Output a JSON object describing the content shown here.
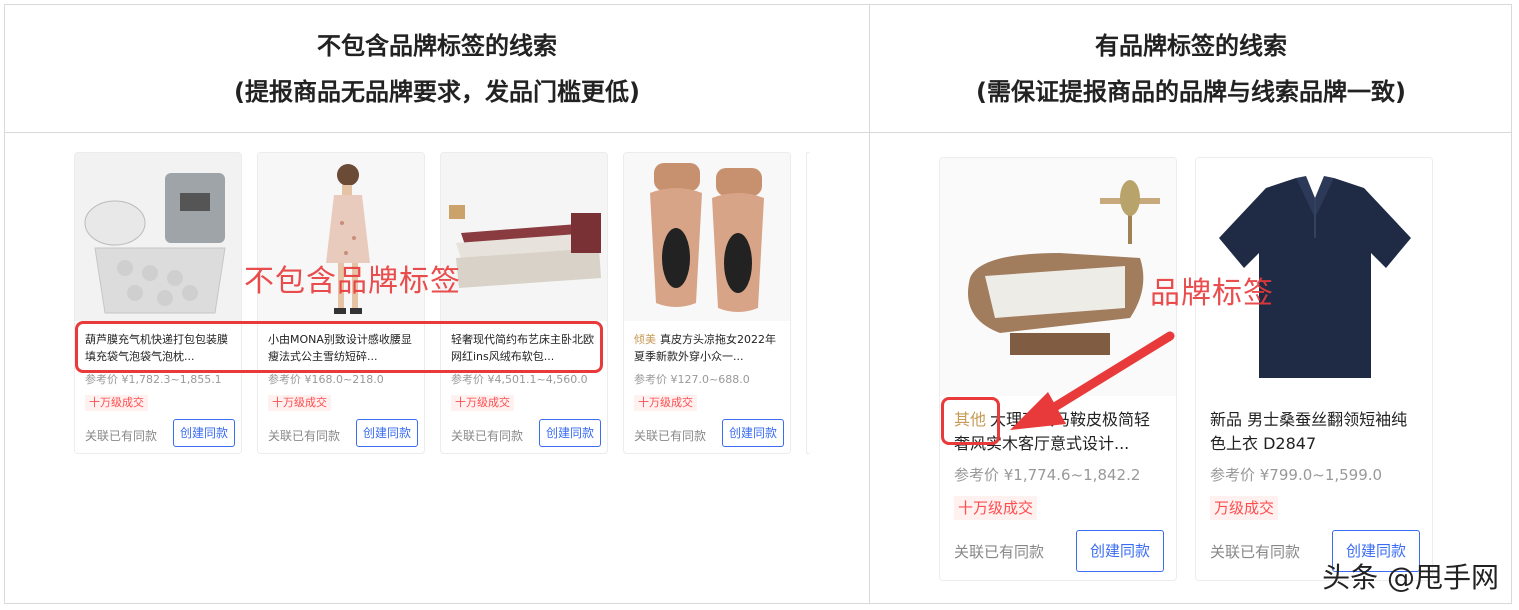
{
  "header": {
    "left_title": "不包含品牌标签的线索",
    "left_subtitle": "(提报商品无品牌要求，发品门槛更低)",
    "right_title": "有品牌标签的线索",
    "right_subtitle": "(需保证提报商品的品牌与线索品牌一致)"
  },
  "left_cards": [
    {
      "title": "葫芦膜充气机快递打包包装膜填充袋气泡袋气泡枕...",
      "price": "参考价 ¥1,782.3~1,855.1",
      "deal": "十万级成交",
      "assoc": "关联已有同款",
      "btn": "创建同款",
      "image": "air-cushion-machine"
    },
    {
      "title": "小由MONA别致设计感收腰显瘦法式公主雪纺短碎...",
      "price": "参考价 ¥168.0~218.0",
      "deal": "十万级成交",
      "assoc": "关联已有同款",
      "btn": "创建同款",
      "image": "floral-dress-model"
    },
    {
      "title": "轻奢现代简约布艺床主卧北欧网红ins风绒布软包...",
      "price": "参考价 ¥4,501.1~4,560.0",
      "deal": "十万级成交",
      "assoc": "关联已有同款",
      "btn": "创建同款",
      "image": "fabric-bed"
    },
    {
      "brand": "倾美",
      "title": "真皮方头凉拖女2022年夏季新款外穿小众一...",
      "price": "参考价 ¥127.0~688.0",
      "deal": "十万级成交",
      "assoc": "关联已有同款",
      "btn": "创建同款",
      "image": "sandals"
    }
  ],
  "right_cards": [
    {
      "brand": "其他",
      "title": "大理石风马鞍皮极简轻奢风实木客厅意式设计...",
      "price": "参考价 ¥1,774.6~1,842.2",
      "deal": "十万级成交",
      "assoc": "关联已有同款",
      "btn": "创建同款",
      "image": "coffee-table"
    },
    {
      "title": "新品 男士桑蚕丝翻领短袖纯色上衣 D2847",
      "price": "参考价 ¥799.0~1,599.0",
      "deal": "万级成交",
      "assoc": "关联已有同款",
      "btn": "创建同款",
      "image": "polo-shirt"
    }
  ],
  "annotations": {
    "left": "不包含品牌标签",
    "right": "品牌标签"
  },
  "watermark": "头条 @甩手网",
  "colors": {
    "accent_red": "#e83a3a",
    "button_blue": "#3a6cf4",
    "brand_gold": "#c89a56"
  }
}
